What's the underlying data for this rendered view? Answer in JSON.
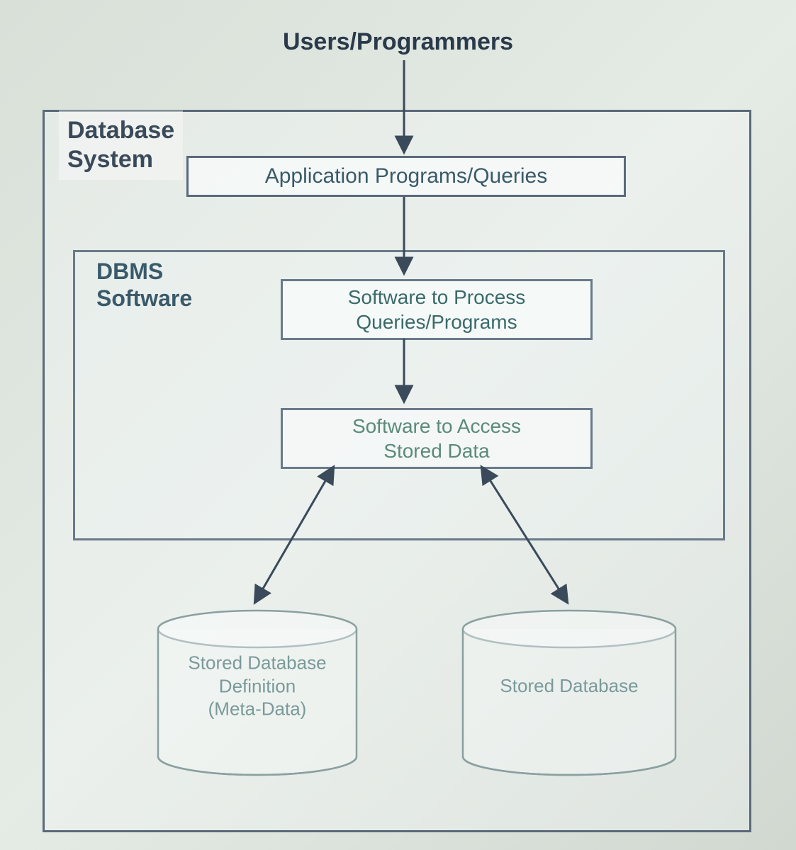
{
  "diagram": {
    "title": "Users/Programmers",
    "db_system_label_line1": "Database",
    "db_system_label_line2": "System",
    "application_box": "Application Programs/Queries",
    "dbms_label_line1": "DBMS",
    "dbms_label_line2": "Software",
    "process_box_line1": "Software to Process",
    "process_box_line2": "Queries/Programs",
    "access_box_line1": "Software to Access",
    "access_box_line2": "Stored Data",
    "cylinder_left_line1": "Stored Database",
    "cylinder_left_line2": "Definition",
    "cylinder_left_line3": "(Meta-Data)",
    "cylinder_right": "Stored Database"
  }
}
